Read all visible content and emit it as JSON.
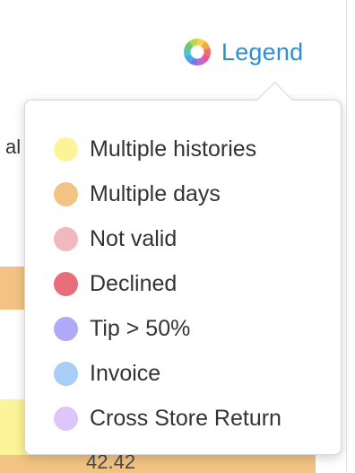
{
  "background": {
    "column_header_fragment": "al",
    "bottom_value": "42.42",
    "row_colors": {
      "multiple_days": "#f2c383",
      "multiple_histories": "#fdf499"
    }
  },
  "legend": {
    "toggle_label": "Legend",
    "icon": "color-wheel-icon",
    "link_color": "#2f8dd3",
    "items": [
      {
        "label": "Multiple histories",
        "color": "#fdf499"
      },
      {
        "label": "Multiple days",
        "color": "#f2c383"
      },
      {
        "label": "Not valid",
        "color": "#f2b8c0"
      },
      {
        "label": "Declined",
        "color": "#e96c7b"
      },
      {
        "label": "Tip > 50%",
        "color": "#aeaaf7"
      },
      {
        "label": "Invoice",
        "color": "#a8cdf6"
      },
      {
        "label": "Cross Store Return",
        "color": "#dcc6fb"
      }
    ]
  }
}
